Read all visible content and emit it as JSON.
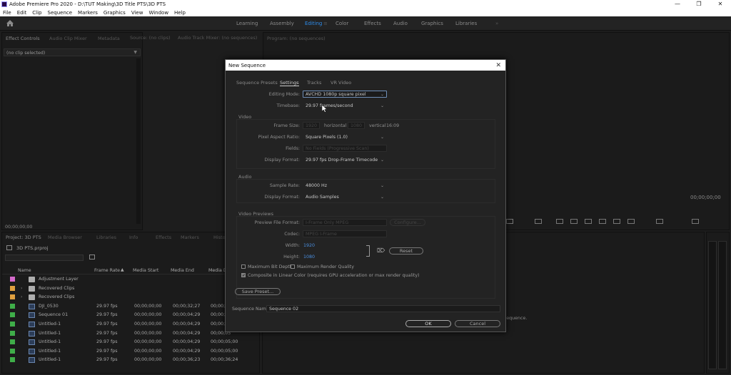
{
  "titlebar": {
    "title": "Adobe Premiere Pro 2020 - D:\\TUT Making\\3D Title PTS\\3D PTS",
    "minimize": "—",
    "restore": "❐",
    "close": "✕"
  },
  "menu": [
    "File",
    "Edit",
    "Clip",
    "Sequence",
    "Markers",
    "Graphics",
    "View",
    "Window",
    "Help"
  ],
  "workspaces": [
    "Learning",
    "Assembly",
    "Editing",
    "Color",
    "Effects",
    "Audio",
    "Graphics",
    "Libraries"
  ],
  "workspace_menu": "≡",
  "workspace_more": "»",
  "source_panel": {
    "tabs": [
      "Effect Controls",
      "Audio Clip Mixer",
      "Metadata",
      "Source: (no clips)",
      "Audio Track Mixer: (no sequences)"
    ],
    "no_clip": "(no clip selected)",
    "timecode": "00;00;00;00"
  },
  "program_panel": {
    "tab": "Program: (no sequences)",
    "timecode": "00;00;00;00"
  },
  "project_panel": {
    "tabs": [
      "Project: 3D PTS",
      "Media Browser",
      "Libraries",
      "Info",
      "Effects",
      "Markers",
      "History"
    ],
    "project_file": "3D PTS.prproj",
    "columns": [
      "Name",
      "Frame Rate",
      "Media Start",
      "Media End",
      "Media Du"
    ],
    "rows": [
      {
        "name": "Adjustment Layer",
        "color": "#d46acb",
        "type": "file",
        "fr": "",
        "ms": "",
        "me": "",
        "md": ""
      },
      {
        "name": "Recovered Clips",
        "color": "#e0a040",
        "type": "folder",
        "fr": "",
        "ms": "",
        "me": "",
        "md": ""
      },
      {
        "name": "Recovered Clips",
        "color": "#e0a040",
        "type": "folder",
        "fr": "",
        "ms": "",
        "me": "",
        "md": ""
      },
      {
        "name": "DJI_0530",
        "color": "#3fae49",
        "type": "clip",
        "fr": "29.97 fps",
        "ms": "00;00;00;00",
        "me": "00;00;32;27",
        "md": "00;00;32"
      },
      {
        "name": "Sequence 01",
        "color": "#3fae49",
        "type": "clip",
        "fr": "29.97 fps",
        "ms": "00;00;00;00",
        "me": "00;00;04;29",
        "md": "00;00;05"
      },
      {
        "name": "Untitled-1",
        "color": "#3fae49",
        "type": "clip",
        "fr": "29.97 fps",
        "ms": "00;00;00;00",
        "me": "00;00;04;29",
        "md": "00;00;05"
      },
      {
        "name": "Untitled-1",
        "color": "#3fae49",
        "type": "clip",
        "fr": "29.97 fps",
        "ms": "00;00;00;00",
        "me": "00;00;04;29",
        "md": "00;00;05"
      },
      {
        "name": "Untitled-1",
        "color": "#3fae49",
        "type": "clip",
        "fr": "29.97 fps",
        "ms": "00;00;00;00",
        "me": "00;00;04;29",
        "md": "00;00;05;00"
      },
      {
        "name": "Untitled-1",
        "color": "#3fae49",
        "type": "clip",
        "fr": "29.97 fps",
        "ms": "00;00;00;00",
        "me": "00;00;04;29",
        "md": "00;00;05;00"
      },
      {
        "name": "Untitled-1",
        "color": "#3fae49",
        "type": "clip",
        "fr": "29.97 fps",
        "ms": "00;00;00;00",
        "me": "00;00;36;23",
        "md": "00;00;36;24"
      }
    ]
  },
  "timeline_hint": "sequence.",
  "dialog": {
    "title": "New Sequence",
    "close": "✕",
    "tabs": [
      "Sequence Presets",
      "Settings",
      "Tracks",
      "VR Video"
    ],
    "editing_mode": {
      "label": "Editing Mode:",
      "value": "AVCHD 1080p square pixel"
    },
    "timebase": {
      "label": "Timebase:",
      "value": "29.97  frames/second"
    },
    "video": {
      "heading": "Video",
      "frame_size": {
        "label": "Frame Size:",
        "h": "1920",
        "hlabel": "horizontal",
        "v": "1080",
        "vlabel": "vertical",
        "ratio": "16:09"
      },
      "par": {
        "label": "Pixel Aspect Ratio:",
        "value": "Square Pixels (1.0)"
      },
      "fields": {
        "label": "Fields:",
        "value": "No Fields (Progressive Scan)"
      },
      "display": {
        "label": "Display Format:",
        "value": "29.97 fps Drop-Frame Timecode"
      }
    },
    "audio": {
      "heading": "Audio",
      "rate": {
        "label": "Sample Rate:",
        "value": "48000 Hz"
      },
      "display": {
        "label": "Display Format:",
        "value": "Audio Samples"
      }
    },
    "previews": {
      "heading": "Video Previews",
      "format": {
        "label": "Preview File Format:",
        "value": "I-Frame Only MPEG",
        "configure": "Configure..."
      },
      "codec": {
        "label": "Codec:",
        "value": "MPEG I-Frame"
      },
      "width": {
        "label": "Width:",
        "value": "1920"
      },
      "height": {
        "label": "Height:",
        "value": "1080"
      },
      "reset": "Reset"
    },
    "max_bit_depth": "Maximum Bit Depth",
    "max_render": "Maximum Render Quality",
    "linear": "Composite in Linear Color (requires GPU acceleration or max render quality)",
    "save_preset": "Save Preset...",
    "seq_name": {
      "label": "Sequence Name:",
      "value": "Sequence 02"
    },
    "ok": "OK",
    "cancel": "Cancel"
  }
}
